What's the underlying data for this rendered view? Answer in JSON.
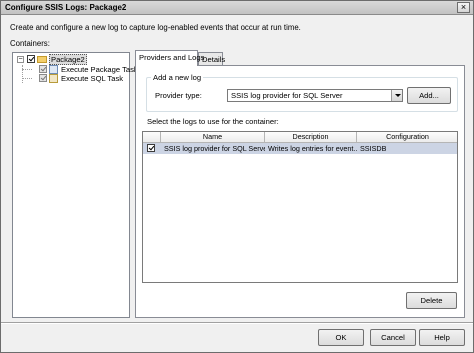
{
  "window": {
    "title": "Configure SSIS Logs: Package2",
    "close_label": "×"
  },
  "description": "Create and configure a new log to capture log-enabled events that occur at run time.",
  "containers_label": "Containers:",
  "tree": {
    "root": {
      "label": "Package2",
      "checked": true,
      "expander": "−"
    },
    "children": [
      {
        "label": "Execute Package Task",
        "checked": true
      },
      {
        "label": "Execute SQL Task",
        "checked": true
      }
    ]
  },
  "tabs": [
    {
      "label": "Providers and Logs",
      "active": true
    },
    {
      "label": "Details",
      "active": false
    }
  ],
  "add_log_group": {
    "legend": "Add a new log",
    "provider_type_label": "Provider type:",
    "provider_type_value": "SSIS log provider for SQL Server",
    "add_button": "Add..."
  },
  "logs_label": "Select the logs to use for the container:",
  "logs_table": {
    "columns": [
      "Name",
      "Description",
      "Configuration"
    ],
    "rows": [
      {
        "checked": true,
        "name": "SSIS log provider for SQL Server",
        "description": "Writes log entries for event...",
        "configuration": "SSISDB"
      }
    ]
  },
  "delete_button": "Delete",
  "footer": {
    "ok": "OK",
    "cancel": "Cancel",
    "help": "Help"
  },
  "colors": {
    "title_bar": "#c9c9c9",
    "selected_row": "#ccd4e4"
  }
}
